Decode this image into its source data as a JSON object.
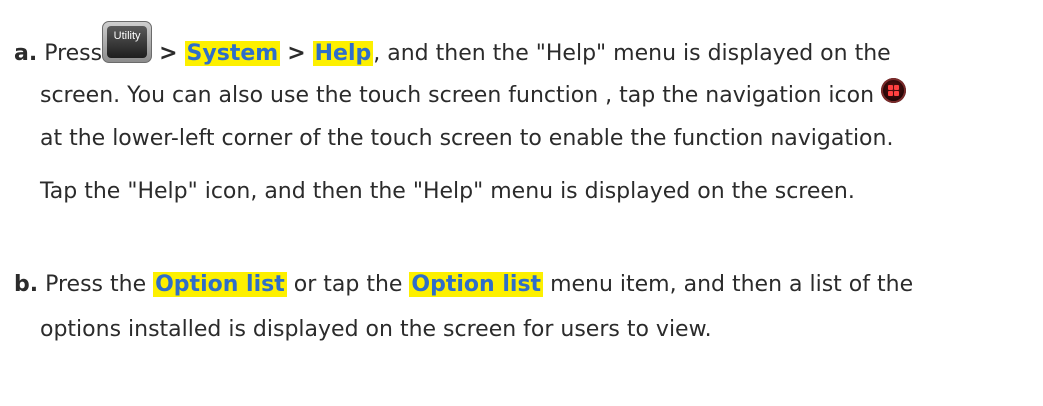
{
  "step_a": {
    "marker": "a.",
    "press": "Press",
    "key_label": "Utility",
    "sep1": ">",
    "system": "System",
    "sep2": ">",
    "help": "Help",
    "rest": ", and then the \"Help\" menu is displayed on the",
    "line2": "screen. You can also use the touch screen function , tap the navigation icon",
    "line3": "at the lower-left corner of the touch screen to enable the function navigation.",
    "line4": "Tap the \"Help\" icon, and then the \"Help\" menu is displayed on the screen."
  },
  "step_b": {
    "marker": "b.",
    "part1": "Press the",
    "option_list_1": "Option list",
    "part2": "or tap the",
    "option_list_2": "Option list",
    "part3": "menu item, and then a list of the",
    "line2": "options installed is displayed on the screen for users to view."
  },
  "colors": {
    "highlight": "#fdf000",
    "highlight_text": "#2f6ec9",
    "body_text": "#2b2b2b"
  },
  "icons": [
    "utility-key-icon",
    "navigation-icon"
  ]
}
